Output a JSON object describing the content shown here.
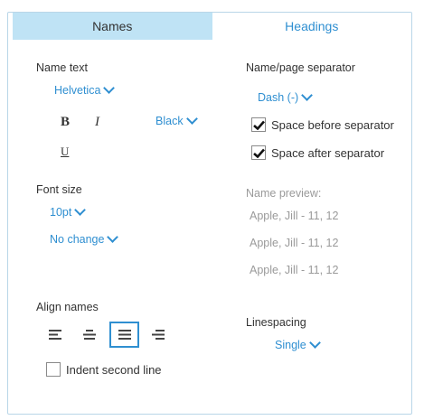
{
  "tabs": [
    {
      "label": "Names",
      "active": true
    },
    {
      "label": "Headings",
      "active": false
    }
  ],
  "name_text": {
    "label": "Name text",
    "font": "Helvetica",
    "bold_label": "B",
    "italic_label": "I",
    "underline_label": "U",
    "color": "Black"
  },
  "font_size": {
    "label": "Font size",
    "size": "10pt",
    "change": "No change"
  },
  "align_names": {
    "label": "Align names",
    "options": [
      "align-left",
      "align-center",
      "align-justify",
      "align-right"
    ],
    "selected": "align-justify",
    "indent_label": "Indent second line",
    "indent_checked": false
  },
  "separator": {
    "label": "Name/page separator",
    "value": "Dash (-)",
    "space_before_label": "Space before separator",
    "space_before_checked": true,
    "space_after_label": "Space after separator",
    "space_after_checked": true
  },
  "preview": {
    "label": "Name preview:",
    "lines": [
      "Apple, Jill - 11, 12",
      "Apple, Jill - 11, 12",
      "Apple, Jill - 11, 12"
    ]
  },
  "linespacing": {
    "label": "Linespacing",
    "value": "Single"
  },
  "colors": {
    "accent": "#2f8fd1",
    "tab_active_bg": "#bfe3f5",
    "panel_border": "#b9d6e8"
  }
}
